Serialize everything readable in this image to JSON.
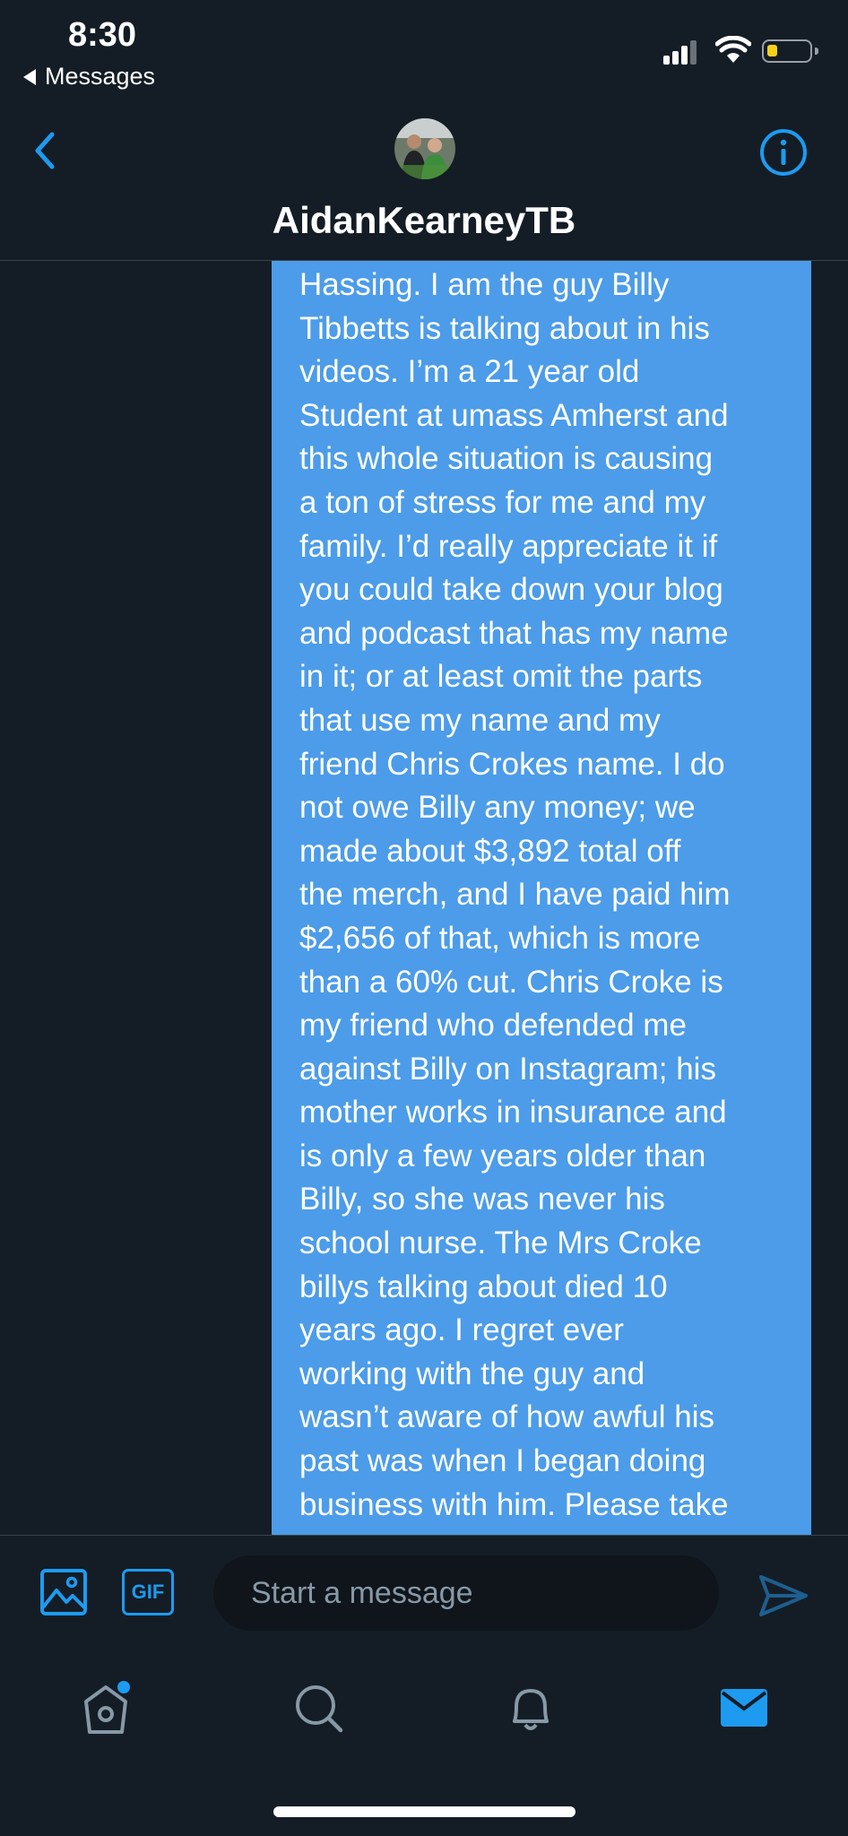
{
  "status": {
    "time": "8:30",
    "back_app": "Messages"
  },
  "header": {
    "contact_name": "AidanKearneyTB"
  },
  "message": {
    "text": "Hassing. I am the guy Billy\nTibbetts is talking about in his\nvideos. I’m a 21 year old\nStudent at umass Amherst and\nthis whole situation is causing\na ton of stress for me and my\nfamily. I’d really appreciate it if\nyou could take down your blog\nand podcast that has my name\nin it; or at least omit the parts\nthat use my name and my\nfriend Chris Crokes name. I do\nnot owe Billy any money; we\nmade about $3,892 total off\nthe merch, and I have paid him\n$2,656 of that, which is more\nthan a 60% cut. Chris Croke is\nmy friend who defended me\nagainst Billy on Instagram; his\nmother works in insurance and\nis only a few years older than\nBilly, so she was never his\nschool nurse. The Mrs Croke\nbillys talking about died 10\nyears ago. I regret ever\nworking with the guy and\nwasn’t aware of how awful his\npast was when I began doing\nbusiness with him. Please take"
  },
  "composer": {
    "gif_label": "GIF",
    "placeholder": "Start a message"
  },
  "colors": {
    "background": "#141d26",
    "bubble": "#4c9ce9",
    "accent": "#1d9bf0",
    "muted": "#8899a6",
    "battery_fill": "#f5d21a"
  },
  "icons": [
    "chevron-left-icon",
    "info-icon",
    "image-icon",
    "gif-icon",
    "send-icon",
    "home-icon",
    "search-icon",
    "bell-icon",
    "mail-icon"
  ],
  "tabs": [
    {
      "name": "home",
      "has_notification_dot": true,
      "active": false
    },
    {
      "name": "search",
      "active": false
    },
    {
      "name": "notifications",
      "active": false
    },
    {
      "name": "messages",
      "active": true
    }
  ]
}
